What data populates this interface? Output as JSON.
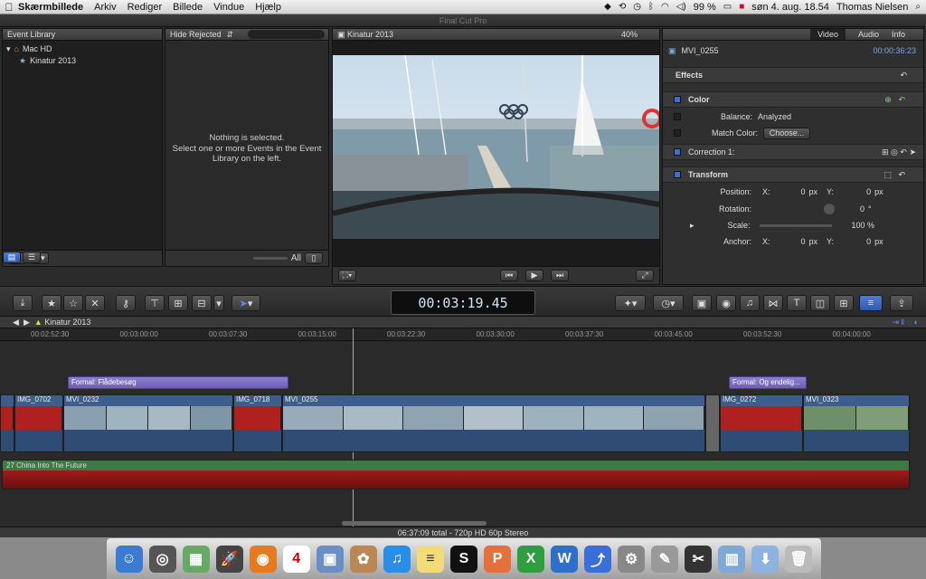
{
  "menubar": {
    "apple": "",
    "app_name": "Skærmbillede",
    "menus": [
      "Arkiv",
      "Rediger",
      "Billede",
      "Vindue",
      "Hjælp"
    ],
    "battery": "99 %",
    "datetime": "søn 4. aug. 18.54",
    "user": "Thomas Nielsen"
  },
  "window": {
    "title": "Final Cut Pro"
  },
  "library": {
    "header": "Event Library",
    "drive": "Mac HD",
    "event": "Kinatur 2013"
  },
  "browser": {
    "filter": "Hide Rejected",
    "empty_line1": "Nothing is selected.",
    "empty_line2": "Select one or more Events in the Event",
    "empty_line3": "Library on the left.",
    "all_label": "All"
  },
  "viewer": {
    "title": "Kinatur 2013",
    "zoom": "40%"
  },
  "inspector": {
    "tabs": [
      "Video",
      "Audio",
      "Info"
    ],
    "clip_name": "MVI_0255",
    "clip_duration": "00:00:36:23",
    "effects": "Effects",
    "color": "Color",
    "balance_label": "Balance:",
    "balance_value": "Analyzed",
    "match_color_label": "Match Color:",
    "choose_label": "Choose...",
    "correction": "Correction 1:",
    "transform": "Transform",
    "position_label": "Position:",
    "x_label": "X:",
    "x_value": "0",
    "px": "px",
    "y_label": "Y:",
    "y_value": "0",
    "rotation_label": "Rotation:",
    "rotation_value": "0",
    "deg": "°",
    "scale_label": "Scale:",
    "scale_value": "100 %",
    "anchor_label": "Anchor:",
    "anchor_x": "0",
    "anchor_y": "0"
  },
  "toolbar": {
    "timecode": "00:03:19.45",
    "tc_units": [
      "HR",
      "MIN",
      "SEC",
      "FR"
    ]
  },
  "timeline": {
    "project": "Kinatur 2013",
    "ticks": [
      "00:02:52:30",
      "00:03:00:00",
      "00:03:07:30",
      "00:03:15:00",
      "00:03:22:30",
      "00:03:30:00",
      "00:03:37:30",
      "00:03:45:00",
      "00:03:52:30",
      "00:04:00:00"
    ],
    "titles": [
      "Formal: Flådebesøg",
      "Formal: Og endelig..."
    ],
    "clips": [
      "IMG_0702",
      "MVI_0232",
      "IMG_0718",
      "MVI_0255",
      "IMG_0272",
      "MVI_0323"
    ],
    "audio_clip": "27 China Into The Future"
  },
  "status": {
    "text": "06:37:09 total - 720p HD 60p Stereo"
  },
  "colors": {
    "accent": "#3b6fd8",
    "clip": "#3d5d8c",
    "audio": "#3d7a44",
    "title": "#8f7fd0"
  }
}
